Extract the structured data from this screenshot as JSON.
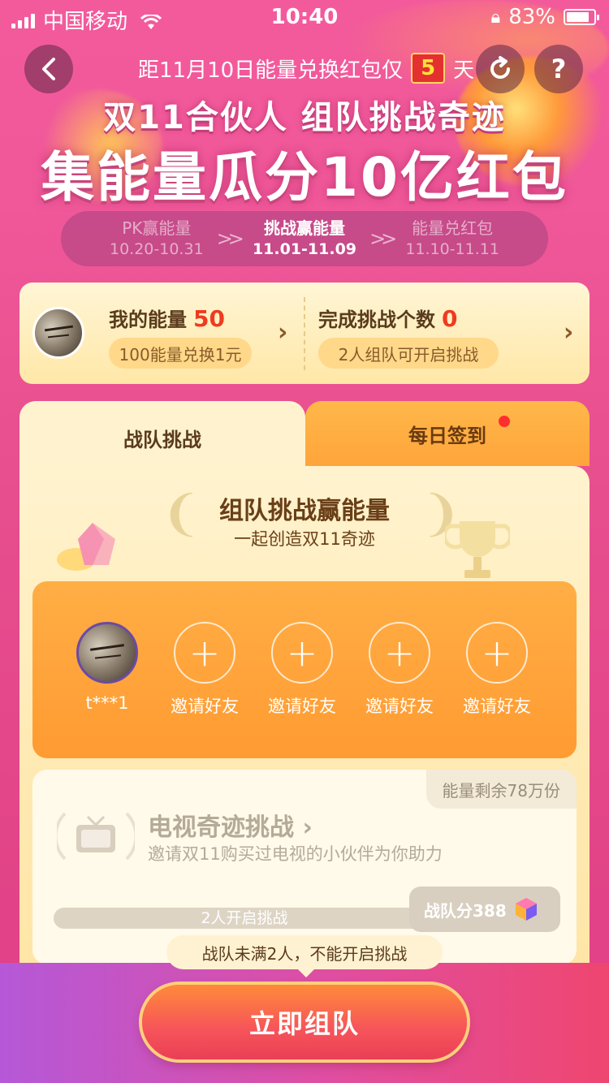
{
  "status_bar": {
    "carrier": "中国移动",
    "time": "10:40",
    "battery_percent": "83%",
    "battery_level": 0.83
  },
  "header": {
    "countdown_prefix": "距11月10日能量兑换红包仅",
    "countdown_days": "5",
    "countdown_suffix": "天",
    "title_line1": "双11合伙人 组队挑战奇迹",
    "title_line2": "集能量瓜分10亿红包",
    "help_label": "?"
  },
  "phases": [
    {
      "label": "PK赢能量",
      "date": "10.20-10.31",
      "active": false
    },
    {
      "label": "挑战赢能量",
      "date": "11.01-11.09",
      "active": true
    },
    {
      "label": "能量兑红包",
      "date": "11.10-11.11",
      "active": false
    }
  ],
  "energy_card": {
    "my_energy_label": "我的能量",
    "my_energy_value": "50",
    "exchange_note": "100能量兑换1元",
    "challenges_label": "完成挑战个数",
    "challenges_value": "0",
    "challenges_note": "2人组队可开启挑战"
  },
  "tabs": [
    {
      "label": "战队挑战",
      "active": true
    },
    {
      "label": "每日签到",
      "active": false,
      "has_dot": true
    }
  ],
  "panel": {
    "title": "组队挑战赢能量",
    "subtitle": "一起创造双11奇迹"
  },
  "team": {
    "members": [
      {
        "name": "t***1",
        "type": "avatar"
      },
      {
        "name": "邀请好友",
        "type": "invite"
      },
      {
        "name": "邀请好友",
        "type": "invite"
      },
      {
        "name": "邀请好友",
        "type": "invite"
      },
      {
        "name": "邀请好友",
        "type": "invite"
      }
    ],
    "invite_symbol": "+"
  },
  "challenge": {
    "remain": "能量剩余78万份",
    "title": "电视奇迹挑战 ›",
    "description": "邀请双11购买过电视的小伙伴为你助力",
    "progress_label": "2人开启挑战",
    "progress_fraction": 0.0,
    "score_label": "战队分388"
  },
  "bottom": {
    "tooltip": "战队未满2人，不能开启挑战",
    "cta_label": "立即组队"
  },
  "colors": {
    "accent_red": "#f03a1f",
    "orange": "#ff9b32",
    "pink_bg": "#e8508f"
  }
}
